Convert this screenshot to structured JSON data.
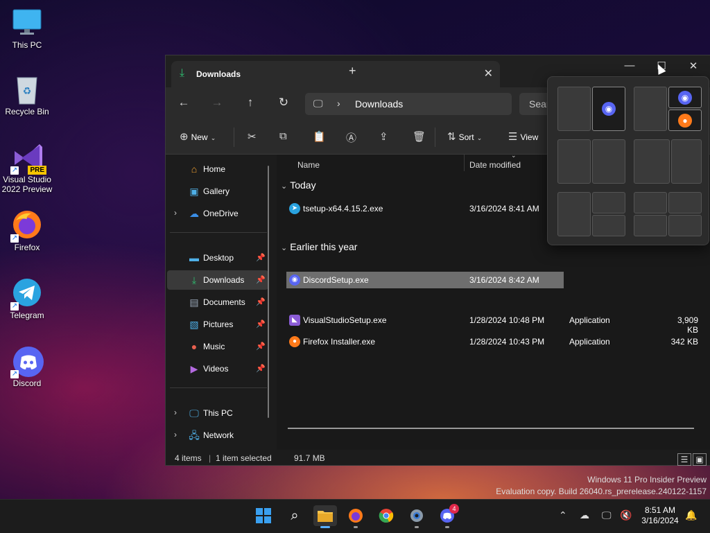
{
  "desktop": {
    "icons": [
      {
        "label": "This PC",
        "icon": "monitor-icon"
      },
      {
        "label": "Recycle Bin",
        "icon": "recycle-bin-icon"
      },
      {
        "label": "Visual Studio 2022 Preview",
        "badge": "PRE",
        "icon": "visual-studio-icon"
      },
      {
        "label": "Firefox",
        "icon": "firefox-icon"
      },
      {
        "label": "Telegram",
        "icon": "telegram-icon"
      },
      {
        "label": "Discord",
        "icon": "discord-icon"
      }
    ]
  },
  "window": {
    "tab_title": "Downloads",
    "address_path": "Downloads",
    "search_placeholder": "Searc",
    "toolbar": {
      "new_label": "New",
      "sort_label": "Sort",
      "view_label": "View"
    },
    "sidebar": {
      "items": [
        {
          "label": "Home",
          "icon": "home-icon"
        },
        {
          "label": "Gallery",
          "icon": "gallery-icon"
        },
        {
          "label": "OneDrive",
          "icon": "onedrive-icon"
        },
        {
          "label": "Desktop",
          "icon": "desktop-folder-icon"
        },
        {
          "label": "Downloads",
          "icon": "downloads-folder-icon"
        },
        {
          "label": "Documents",
          "icon": "documents-folder-icon"
        },
        {
          "label": "Pictures",
          "icon": "pictures-folder-icon"
        },
        {
          "label": "Music",
          "icon": "music-folder-icon"
        },
        {
          "label": "Videos",
          "icon": "videos-folder-icon"
        },
        {
          "label": "This PC",
          "icon": "this-pc-icon"
        },
        {
          "label": "Network",
          "icon": "network-icon"
        }
      ]
    },
    "columns": {
      "name": "Name",
      "date": "Date modified"
    },
    "groups": {
      "today": "Today",
      "earlier": "Earlier this year"
    },
    "files": [
      {
        "name": "tsetup-x64.4.15.2.exe",
        "date": "3/16/2024 8:41 AM",
        "type": "",
        "size": ""
      },
      {
        "name": "DiscordSetup.exe",
        "date": "3/16/2024 8:42 AM",
        "type": "",
        "size": ""
      },
      {
        "name": "VisualStudioSetup.exe",
        "date": "1/28/2024 10:48 PM",
        "type": "Application",
        "size": "3,909 KB"
      },
      {
        "name": "Firefox Installer.exe",
        "date": "1/28/2024 10:43 PM",
        "type": "Application",
        "size": "342 KB"
      }
    ],
    "status": {
      "items": "4 items",
      "selected": "1 item selected",
      "size": "91.7 MB"
    }
  },
  "watermark": {
    "line1": "Windows 11 Pro Insider Preview",
    "line2": "Evaluation copy. Build 26040.rs_prerelease.240122-1157"
  },
  "taskbar": {
    "apps": [
      "start-icon",
      "search-icon",
      "file-explorer-icon",
      "firefox-icon",
      "chrome-icon",
      "settings-icon",
      "discord-icon"
    ],
    "discord_badge": "4",
    "time": "8:51 AM",
    "date": "3/16/2024"
  },
  "colors": {
    "accent": "#5ab0ff",
    "discord": "#5865f2",
    "telegram": "#2aa3e0",
    "downloads_green": "#2fbf71"
  }
}
